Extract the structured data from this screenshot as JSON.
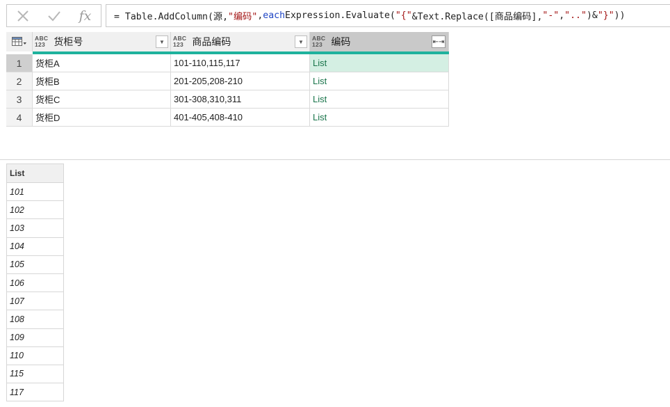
{
  "formula_bar": {
    "cancel_icon": "close-icon",
    "confirm_icon": "check-icon",
    "fx_label": "fx",
    "formula": [
      {
        "t": "plain",
        "v": "= Table.AddColumn(源, "
      },
      {
        "t": "str",
        "v": "\"编码\""
      },
      {
        "t": "plain",
        "v": ", "
      },
      {
        "t": "kw",
        "v": "each"
      },
      {
        "t": "plain",
        "v": " Expression.Evaluate("
      },
      {
        "t": "str",
        "v": "\"{\""
      },
      {
        "t": "plain",
        "v": "&Text.Replace([商品编码],"
      },
      {
        "t": "str",
        "v": "\"-\""
      },
      {
        "t": "plain",
        "v": ","
      },
      {
        "t": "str",
        "v": "\"..\""
      },
      {
        "t": "plain",
        "v": ")&"
      },
      {
        "t": "str",
        "v": "\"}\""
      },
      {
        "t": "plain",
        "v": "))"
      }
    ]
  },
  "table": {
    "columns": [
      {
        "type_top": "ABC",
        "type_bottom": "123",
        "label": "货柜号",
        "selected": false
      },
      {
        "type_top": "ABC",
        "type_bottom": "123",
        "label": "商品编码",
        "selected": false
      },
      {
        "type_top": "ABC",
        "type_bottom": "123",
        "label": "编码",
        "selected": true
      }
    ],
    "rows": [
      {
        "num": "1",
        "cells": [
          "货柜A",
          "101-110,115,117",
          "List"
        ]
      },
      {
        "num": "2",
        "cells": [
          "货柜B",
          "201-205,208-210",
          "List"
        ]
      },
      {
        "num": "3",
        "cells": [
          "货柜C",
          "301-308,310,311",
          "List"
        ]
      },
      {
        "num": "4",
        "cells": [
          "货柜D",
          "401-405,408-410",
          "List"
        ]
      }
    ],
    "selected_row": 0,
    "accent_color": "#1fb29d"
  },
  "preview": {
    "header": "List",
    "items": [
      "101",
      "102",
      "103",
      "104",
      "105",
      "106",
      "107",
      "108",
      "109",
      "110",
      "115",
      "117"
    ]
  }
}
